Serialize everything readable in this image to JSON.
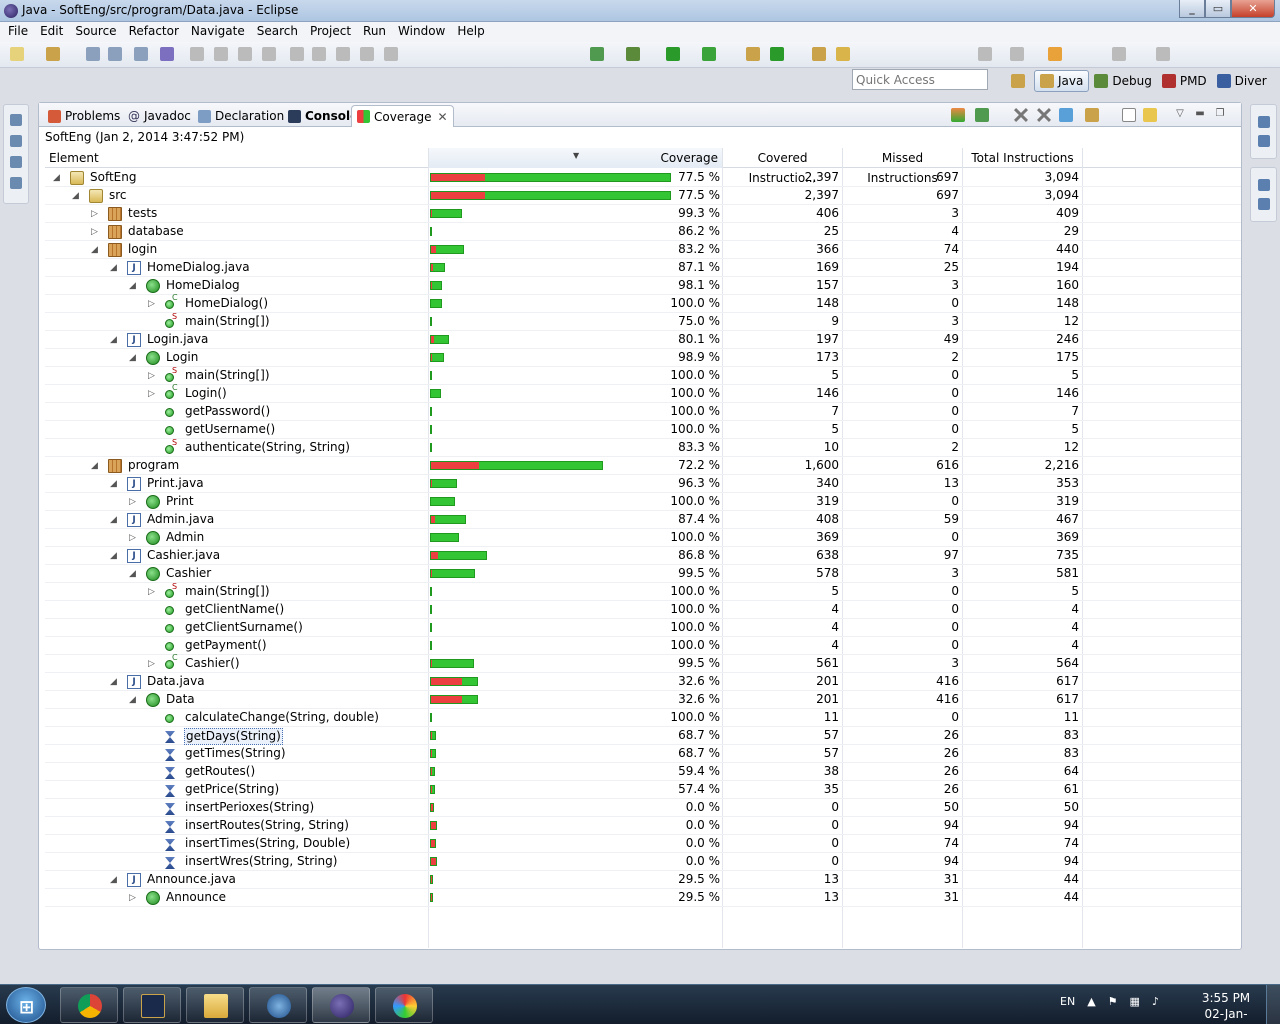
{
  "window": {
    "title": "Java - SoftEng/src/program/Data.java - Eclipse"
  },
  "menu": [
    "File",
    "Edit",
    "Source",
    "Refactor",
    "Navigate",
    "Search",
    "Project",
    "Run",
    "Window",
    "Help"
  ],
  "quick_access": {
    "placeholder": "Quick Access"
  },
  "perspectives": [
    {
      "label": "Java",
      "active": true
    },
    {
      "label": "Debug",
      "active": false
    },
    {
      "label": "PMD",
      "active": false
    },
    {
      "label": "Diver",
      "active": false
    }
  ],
  "tabs": [
    {
      "label": "Problems"
    },
    {
      "label": "Javadoc"
    },
    {
      "label": "Declaration"
    },
    {
      "label": "Console"
    },
    {
      "label": "Coverage",
      "active": true
    }
  ],
  "session": "SoftEng (Jan 2, 2014 3:47:52 PM)",
  "columns": {
    "element": "Element",
    "coverage": "Coverage",
    "covered": "Covered Instructio...",
    "missed": "Missed Instructions",
    "total": "Total Instructions"
  },
  "rows": [
    {
      "name": "SoftEng",
      "level": 0,
      "icon": "project",
      "twisty": "open",
      "pct": "77.5 %",
      "covered": "2,397",
      "missed": "697",
      "total": "3,094"
    },
    {
      "name": "src",
      "level": 1,
      "icon": "source-folder",
      "twisty": "open",
      "pct": "77.5 %",
      "covered": "2,397",
      "missed": "697",
      "total": "3,094"
    },
    {
      "name": "tests",
      "level": 2,
      "icon": "package",
      "twisty": "closed",
      "pct": "99.3 %",
      "covered": "406",
      "missed": "3",
      "total": "409"
    },
    {
      "name": "database",
      "level": 2,
      "icon": "package",
      "twisty": "closed",
      "pct": "86.2 %",
      "covered": "25",
      "missed": "4",
      "total": "29"
    },
    {
      "name": "login",
      "level": 2,
      "icon": "package",
      "twisty": "open",
      "pct": "83.2 %",
      "covered": "366",
      "missed": "74",
      "total": "440"
    },
    {
      "name": "HomeDialog.java",
      "level": 3,
      "icon": "java-file",
      "twisty": "open",
      "pct": "87.1 %",
      "covered": "169",
      "missed": "25",
      "total": "194"
    },
    {
      "name": "HomeDialog",
      "level": 4,
      "icon": "class",
      "twisty": "open",
      "pct": "98.1 %",
      "covered": "157",
      "missed": "3",
      "total": "160"
    },
    {
      "name": "HomeDialog()",
      "level": 5,
      "icon": "constructor",
      "twisty": "closed",
      "pct": "100.0 %",
      "covered": "148",
      "missed": "0",
      "total": "148"
    },
    {
      "name": "main(String[])",
      "level": 5,
      "icon": "static-method",
      "twisty": "none",
      "pct": "75.0 %",
      "covered": "9",
      "missed": "3",
      "total": "12"
    },
    {
      "name": "Login.java",
      "level": 3,
      "icon": "java-file",
      "twisty": "open",
      "pct": "80.1 %",
      "covered": "197",
      "missed": "49",
      "total": "246"
    },
    {
      "name": "Login",
      "level": 4,
      "icon": "class",
      "twisty": "open",
      "pct": "98.9 %",
      "covered": "173",
      "missed": "2",
      "total": "175"
    },
    {
      "name": "main(String[])",
      "level": 5,
      "icon": "static-method",
      "twisty": "closed",
      "pct": "100.0 %",
      "covered": "5",
      "missed": "0",
      "total": "5"
    },
    {
      "name": "Login()",
      "level": 5,
      "icon": "constructor",
      "twisty": "closed",
      "pct": "100.0 %",
      "covered": "146",
      "missed": "0",
      "total": "146"
    },
    {
      "name": "getPassword()",
      "level": 5,
      "icon": "method",
      "twisty": "none",
      "pct": "100.0 %",
      "covered": "7",
      "missed": "0",
      "total": "7"
    },
    {
      "name": "getUsername()",
      "level": 5,
      "icon": "method",
      "twisty": "none",
      "pct": "100.0 %",
      "covered": "5",
      "missed": "0",
      "total": "5"
    },
    {
      "name": "authenticate(String, String)",
      "level": 5,
      "icon": "static-method",
      "twisty": "none",
      "pct": "83.3 %",
      "covered": "10",
      "missed": "2",
      "total": "12"
    },
    {
      "name": "program",
      "level": 2,
      "icon": "package",
      "twisty": "open",
      "pct": "72.2 %",
      "covered": "1,600",
      "missed": "616",
      "total": "2,216"
    },
    {
      "name": "Print.java",
      "level": 3,
      "icon": "java-file",
      "twisty": "open",
      "pct": "96.3 %",
      "covered": "340",
      "missed": "13",
      "total": "353"
    },
    {
      "name": "Print",
      "level": 4,
      "icon": "class",
      "twisty": "closed",
      "pct": "100.0 %",
      "covered": "319",
      "missed": "0",
      "total": "319"
    },
    {
      "name": "Admin.java",
      "level": 3,
      "icon": "java-file",
      "twisty": "open",
      "pct": "87.4 %",
      "covered": "408",
      "missed": "59",
      "total": "467"
    },
    {
      "name": "Admin",
      "level": 4,
      "icon": "class",
      "twisty": "closed",
      "pct": "100.0 %",
      "covered": "369",
      "missed": "0",
      "total": "369"
    },
    {
      "name": "Cashier.java",
      "level": 3,
      "icon": "java-file",
      "twisty": "open",
      "pct": "86.8 %",
      "covered": "638",
      "missed": "97",
      "total": "735"
    },
    {
      "name": "Cashier",
      "level": 4,
      "icon": "class",
      "twisty": "open",
      "pct": "99.5 %",
      "covered": "578",
      "missed": "3",
      "total": "581"
    },
    {
      "name": "main(String[])",
      "level": 5,
      "icon": "static-method",
      "twisty": "closed",
      "pct": "100.0 %",
      "covered": "5",
      "missed": "0",
      "total": "5"
    },
    {
      "name": "getClientName()",
      "level": 5,
      "icon": "method",
      "twisty": "none",
      "pct": "100.0 %",
      "covered": "4",
      "missed": "0",
      "total": "4"
    },
    {
      "name": "getClientSurname()",
      "level": 5,
      "icon": "method",
      "twisty": "none",
      "pct": "100.0 %",
      "covered": "4",
      "missed": "0",
      "total": "4"
    },
    {
      "name": "getPayment()",
      "level": 5,
      "icon": "method",
      "twisty": "none",
      "pct": "100.0 %",
      "covered": "4",
      "missed": "0",
      "total": "4"
    },
    {
      "name": "Cashier()",
      "level": 5,
      "icon": "constructor",
      "twisty": "closed",
      "pct": "99.5 %",
      "covered": "561",
      "missed": "3",
      "total": "564"
    },
    {
      "name": "Data.java",
      "level": 3,
      "icon": "java-file",
      "twisty": "open",
      "pct": "32.6 %",
      "covered": "201",
      "missed": "416",
      "total": "617"
    },
    {
      "name": "Data",
      "level": 4,
      "icon": "class",
      "twisty": "open",
      "pct": "32.6 %",
      "covered": "201",
      "missed": "416",
      "total": "617"
    },
    {
      "name": "calculateChange(String, double)",
      "level": 5,
      "icon": "method",
      "twisty": "none",
      "pct": "100.0 %",
      "covered": "11",
      "missed": "0",
      "total": "11"
    },
    {
      "name": "getDays(String)",
      "level": 5,
      "icon": "private-static-final",
      "twisty": "none",
      "selected": true,
      "pct": "68.7 %",
      "covered": "57",
      "missed": "26",
      "total": "83"
    },
    {
      "name": "getTimes(String)",
      "level": 5,
      "icon": "private-static-final",
      "twisty": "none",
      "pct": "68.7 %",
      "covered": "57",
      "missed": "26",
      "total": "83"
    },
    {
      "name": "getRoutes()",
      "level": 5,
      "icon": "private-static-final",
      "twisty": "none",
      "pct": "59.4 %",
      "covered": "38",
      "missed": "26",
      "total": "64"
    },
    {
      "name": "getPrice(String)",
      "level": 5,
      "icon": "private-static-final",
      "twisty": "none",
      "pct": "57.4 %",
      "covered": "35",
      "missed": "26",
      "total": "61"
    },
    {
      "name": "insertPerioxes(String)",
      "level": 5,
      "icon": "private-static-final",
      "twisty": "none",
      "pct": "0.0 %",
      "covered": "0",
      "missed": "50",
      "total": "50"
    },
    {
      "name": "insertRoutes(String, String)",
      "level": 5,
      "icon": "private-static-final",
      "twisty": "none",
      "pct": "0.0 %",
      "covered": "0",
      "missed": "94",
      "total": "94"
    },
    {
      "name": "insertTimes(String, Double)",
      "level": 5,
      "icon": "private-static-final",
      "twisty": "none",
      "pct": "0.0 %",
      "covered": "0",
      "missed": "74",
      "total": "74"
    },
    {
      "name": "insertWres(String, String)",
      "level": 5,
      "icon": "private-static-final",
      "twisty": "none",
      "pct": "0.0 %",
      "covered": "0",
      "missed": "94",
      "total": "94"
    },
    {
      "name": "Announce.java",
      "level": 3,
      "icon": "java-file",
      "twisty": "open",
      "pct": "29.5 %",
      "covered": "13",
      "missed": "31",
      "total": "44"
    },
    {
      "name": "Announce",
      "level": 4,
      "icon": "class",
      "twisty": "closed",
      "pct": "29.5 %",
      "covered": "13",
      "missed": "31",
      "total": "44"
    }
  ],
  "colors": {
    "covered": "#34c534",
    "missed": "#ec4040"
  },
  "taskbar": {
    "language": "EN",
    "time": "3:55 PM",
    "date": "02-Jan-14"
  }
}
